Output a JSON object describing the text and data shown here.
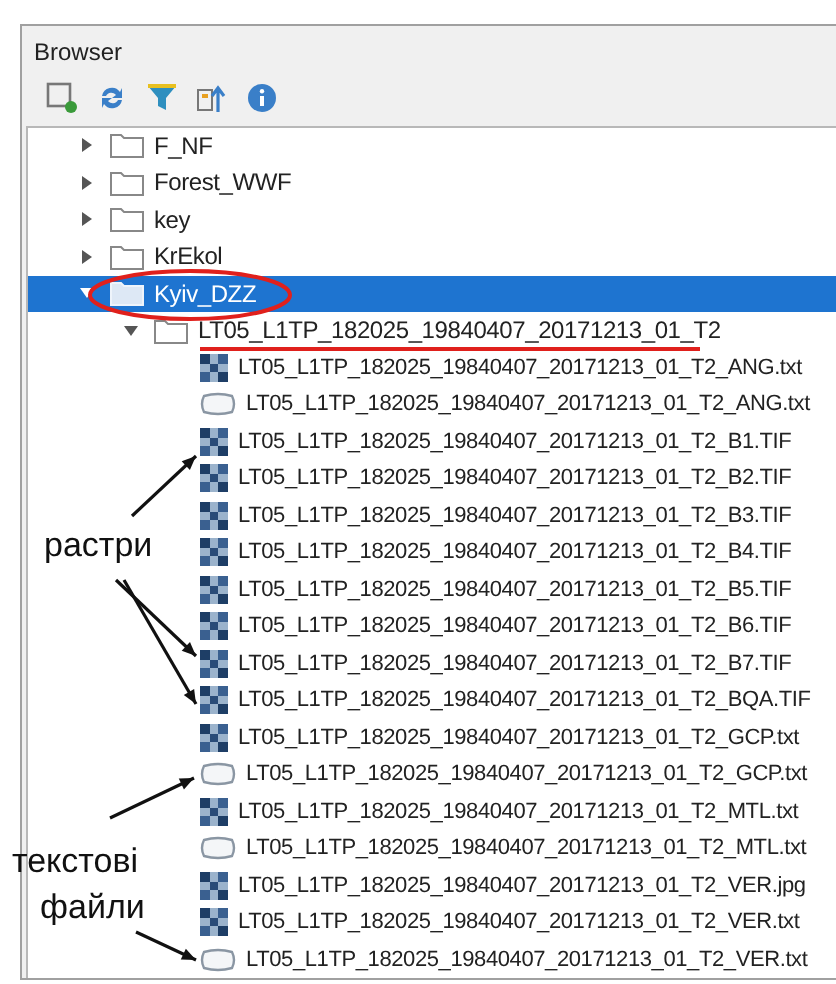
{
  "panel": {
    "title": "Browser"
  },
  "tree": [
    {
      "label": "F_NF",
      "kind": "folder",
      "expanded": false,
      "selected": false
    },
    {
      "label": "Forest_WWF",
      "kind": "folder",
      "expanded": false,
      "selected": false
    },
    {
      "label": "key",
      "kind": "folder",
      "expanded": false,
      "selected": false
    },
    {
      "label": "KrEkol",
      "kind": "folder",
      "expanded": false,
      "selected": false
    },
    {
      "label": "Kyiv_DZZ",
      "kind": "folder",
      "expanded": true,
      "selected": true,
      "children": [
        {
          "label": "LT05_L1TP_182025_19840407_20171213_01_T2",
          "kind": "folder",
          "expanded": true,
          "selected": false,
          "children": [
            {
              "label": "LT05_L1TP_182025_19840407_20171213_01_T2_ANG.txt",
              "kind": "raster",
              "selected": false
            },
            {
              "label": "LT05_L1TP_182025_19840407_20171213_01_T2_ANG.txt",
              "kind": "vector",
              "selected": false
            },
            {
              "label": "LT05_L1TP_182025_19840407_20171213_01_T2_B1.TIF",
              "kind": "raster",
              "selected": false
            },
            {
              "label": "LT05_L1TP_182025_19840407_20171213_01_T2_B2.TIF",
              "kind": "raster",
              "selected": false
            },
            {
              "label": "LT05_L1TP_182025_19840407_20171213_01_T2_B3.TIF",
              "kind": "raster",
              "selected": false
            },
            {
              "label": "LT05_L1TP_182025_19840407_20171213_01_T2_B4.TIF",
              "kind": "raster",
              "selected": false
            },
            {
              "label": "LT05_L1TP_182025_19840407_20171213_01_T2_B5.TIF",
              "kind": "raster",
              "selected": false
            },
            {
              "label": "LT05_L1TP_182025_19840407_20171213_01_T2_B6.TIF",
              "kind": "raster",
              "selected": false
            },
            {
              "label": "LT05_L1TP_182025_19840407_20171213_01_T2_B7.TIF",
              "kind": "raster",
              "selected": false
            },
            {
              "label": "LT05_L1TP_182025_19840407_20171213_01_T2_BQA.TIF",
              "kind": "raster",
              "selected": false
            },
            {
              "label": "LT05_L1TP_182025_19840407_20171213_01_T2_GCP.txt",
              "kind": "raster",
              "selected": false
            },
            {
              "label": "LT05_L1TP_182025_19840407_20171213_01_T2_GCP.txt",
              "kind": "vector",
              "selected": false
            },
            {
              "label": "LT05_L1TP_182025_19840407_20171213_01_T2_MTL.txt",
              "kind": "raster",
              "selected": false
            },
            {
              "label": "LT05_L1TP_182025_19840407_20171213_01_T2_MTL.txt",
              "kind": "vector",
              "selected": false
            },
            {
              "label": "LT05_L1TP_182025_19840407_20171213_01_T2_VER.jpg",
              "kind": "raster",
              "selected": false
            },
            {
              "label": "LT05_L1TP_182025_19840407_20171213_01_T2_VER.txt",
              "kind": "raster",
              "selected": false
            },
            {
              "label": "LT05_L1TP_182025_19840407_20171213_01_T2_VER.txt",
              "kind": "vector",
              "selected": false
            }
          ]
        }
      ]
    }
  ],
  "annotations": [
    {
      "text": "растри"
    },
    {
      "text": "текстові"
    },
    {
      "text": "файли"
    }
  ]
}
